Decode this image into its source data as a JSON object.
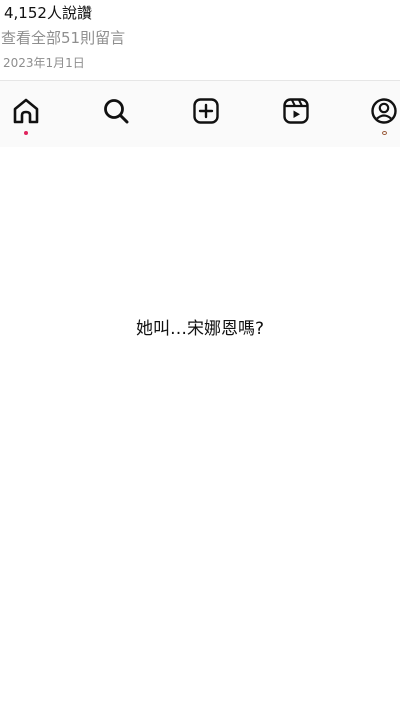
{
  "post": {
    "likes": "4,152人說讚",
    "view_comments": "查看全部51則留言",
    "date": "2023年1月1日"
  },
  "nav": {
    "items": [
      {
        "icon": "home-icon",
        "active": true
      },
      {
        "icon": "search-icon",
        "active": false
      },
      {
        "icon": "new-post-icon",
        "active": false
      },
      {
        "icon": "reels-icon",
        "active": false
      },
      {
        "icon": "profile-icon",
        "active": false
      }
    ],
    "active_color": "#e0245e"
  },
  "main": {
    "caption": "她叫…宋娜恩嗎?"
  }
}
